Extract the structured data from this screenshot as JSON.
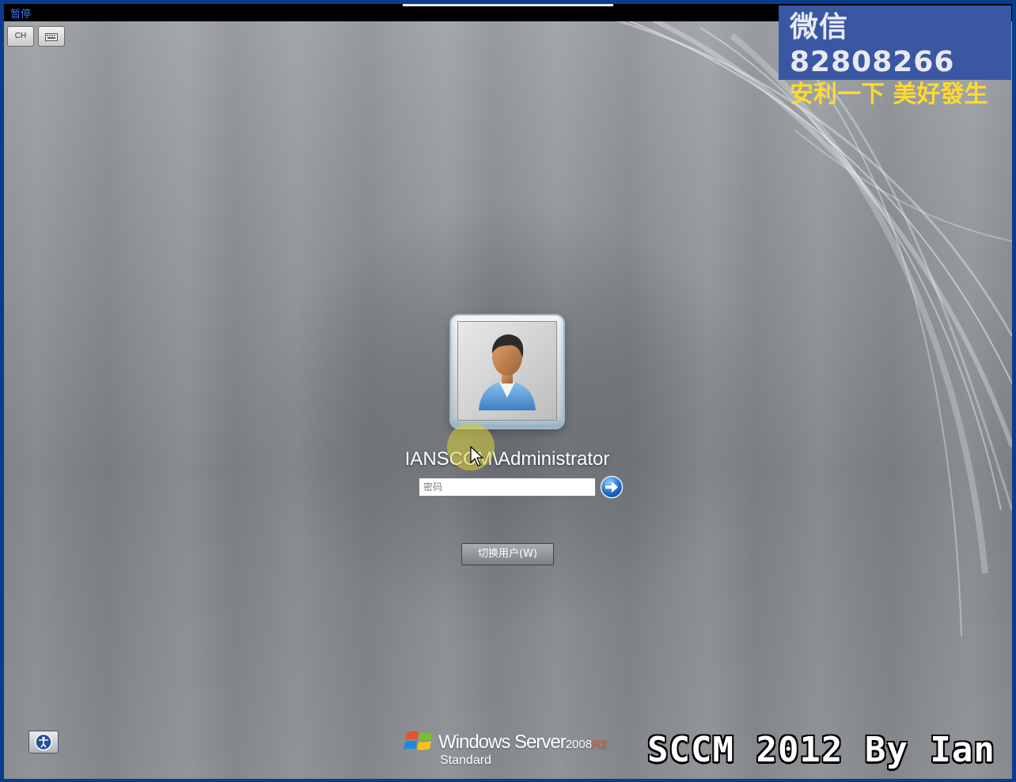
{
  "window": {
    "pause_label": "暂停"
  },
  "toolbar": {
    "language_label": "CH",
    "keyboard_icon": "keyboard-icon"
  },
  "watermark": {
    "line1": "微信 82808266",
    "line2": "安利一下 美好發生"
  },
  "login": {
    "username": "IANSCCM\\Administrator",
    "password_placeholder": "密码",
    "password_value": "",
    "submit_icon": "arrow-right-icon",
    "switch_user_label": "切换用户(W)"
  },
  "ease_of_access": {
    "icon": "ease-of-access-icon"
  },
  "branding": {
    "product_name": "Windows Server",
    "version": "2008",
    "release": "R2",
    "edition": "Standard"
  },
  "overlay_caption": "SCCM 2012 By Ian",
  "colors": {
    "frame_border": "#0a3c8c",
    "watermark_bg": "#3a57a4",
    "watermark_accent": "#ffd92e",
    "pause_text": "#3a78ff",
    "r2_accent": "#e46020",
    "cursor_halo": "#d8d03c"
  }
}
